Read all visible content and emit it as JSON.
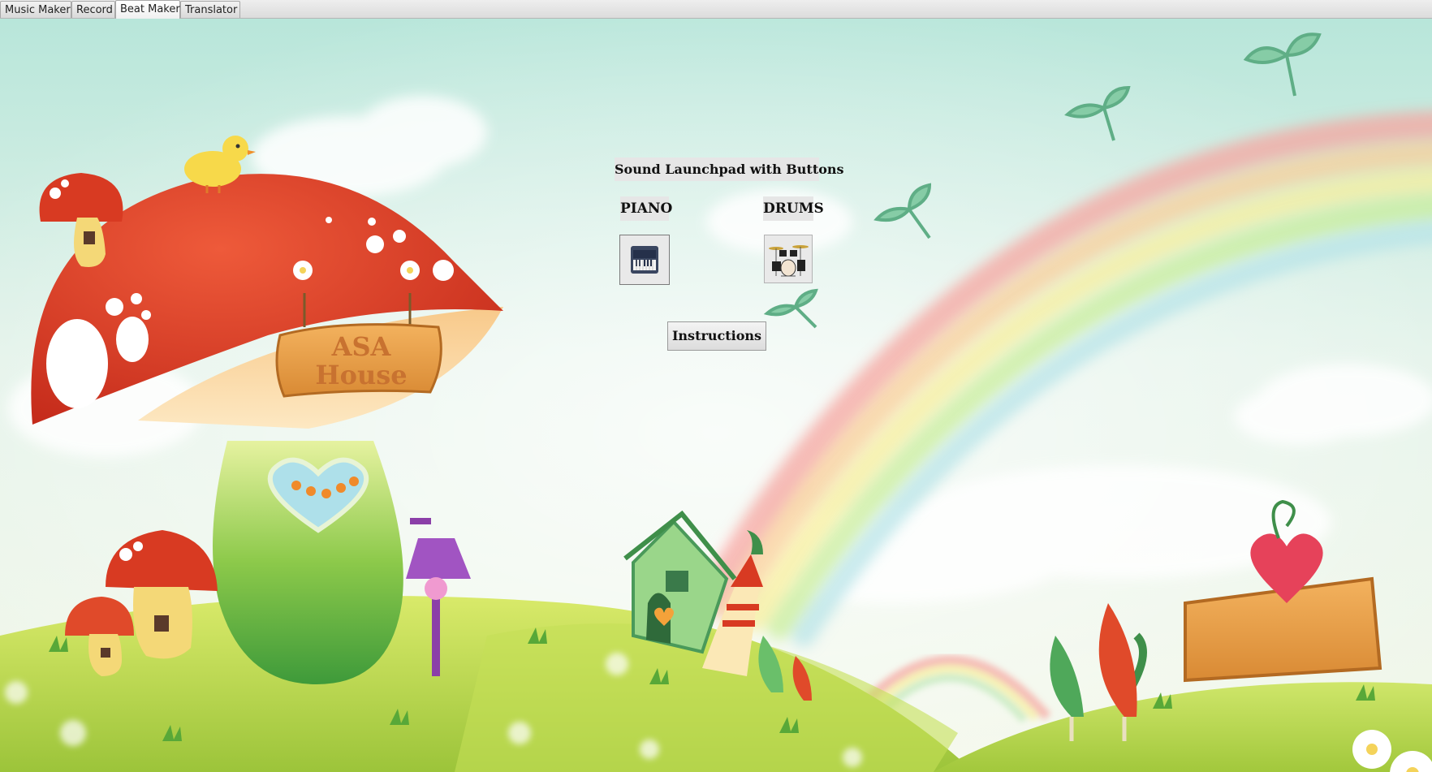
{
  "tabs": [
    {
      "label": "Music Maker",
      "active": false
    },
    {
      "label": "Record",
      "active": false
    },
    {
      "label": "Beat Maker",
      "active": true
    },
    {
      "label": "Translator",
      "active": false
    }
  ],
  "launchpad": {
    "title": "Sound Launchpad with Buttons",
    "piano_label": "PIANO",
    "drums_label": "DRUMS",
    "piano_icon": "piano-keyboard-icon",
    "drums_icon": "drum-kit-icon",
    "instructions_label": "Instructions"
  },
  "background": {
    "sign_text_line1": "ASA",
    "sign_text_line2": "House"
  },
  "colors": {
    "sky_top": "#bfe8e0",
    "grass": "#b9d94a",
    "mushroom_cap": "#d83a22",
    "tab_active": "#ffffff"
  }
}
